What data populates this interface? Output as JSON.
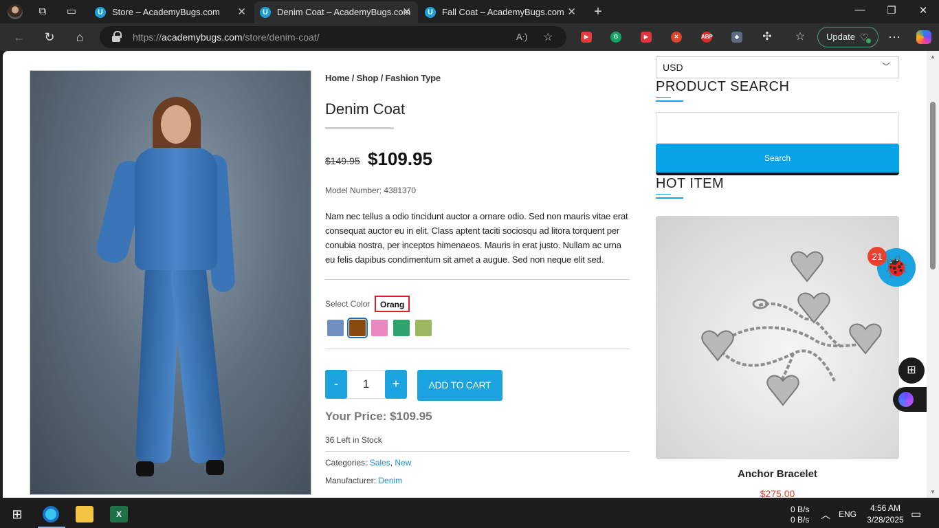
{
  "browser": {
    "tabs": [
      {
        "title": "Store – AcademyBugs.com",
        "active": false
      },
      {
        "title": "Denim Coat – AcademyBugs.com",
        "active": true
      },
      {
        "title": "Fall Coat – AcademyBugs.com",
        "active": false
      }
    ],
    "url_prefix": "https://",
    "url_domain": "academybugs.com",
    "url_path": "/store/denim-coat/",
    "update_label": "Update",
    "extension_icons": [
      "video-ext-icon",
      "grammarly-icon",
      "cast-ext-icon",
      "tool-ext-icon",
      "adblock-plus-icon",
      "shield-ext-icon",
      "puzzle-icon"
    ],
    "abp_label": "ABP"
  },
  "product": {
    "breadcrumb": {
      "home": "Home",
      "shop": "Shop",
      "category": "Fashion Type",
      "sep": " / "
    },
    "title": "Denim Coat",
    "old_price": "$149.95",
    "price": "$109.95",
    "model": "Model Number: 4381370",
    "description": "Nam nec tellus a odio tincidunt auctor a ornare odio. Sed non mauris vitae erat consequat auctor eu in elit. Class aptent taciti sociosqu ad litora torquent per conubia nostra, per inceptos himenaeos. Mauris in erat justo. Nullam ac urna eu felis dapibus condimentum sit amet a augue. Sed non neque elit sed.",
    "select_color_label": "Select Color",
    "selected_color": "Orang",
    "swatches": [
      {
        "name": "Blue",
        "color": "#6f8fc0",
        "selected": false
      },
      {
        "name": "Orang",
        "color": "#8a4b12",
        "selected": true
      },
      {
        "name": "Pink",
        "color": "#e888c0",
        "selected": false
      },
      {
        "name": "Green",
        "color": "#2fa56e",
        "selected": false
      },
      {
        "name": "Olive",
        "color": "#9bb760",
        "selected": false
      }
    ],
    "qty_minus": "-",
    "qty_plus": "+",
    "quantity": "1",
    "add_to_cart": "ADD TO CART",
    "your_price": "Your Price: $109.95",
    "stock": "36 Left in Stock",
    "categories_label": "Categories:",
    "categories": [
      "Sales",
      "New"
    ],
    "categories_sep": ", ",
    "manufacturer_label": "Manufacturer:",
    "manufacturer": "Denim"
  },
  "sidebar": {
    "currency": "USD",
    "search_heading": "PRODUCT SEARCH",
    "search_button": "Search",
    "hot_heading": "HOT ITEM",
    "hot_item_name": "Anchor Bracelet",
    "hot_item_price": "$275.00"
  },
  "widgets": {
    "bug_count": "21"
  },
  "taskbar": {
    "net_up": "0 B/s",
    "net_down": "0 B/s",
    "lang": "ENG",
    "time": "4:56 AM",
    "date": "3/28/2025"
  },
  "colors": {
    "accent": "#1aa3e0",
    "highlight_border": "#e01b24",
    "sale_price": "#d0442c"
  }
}
